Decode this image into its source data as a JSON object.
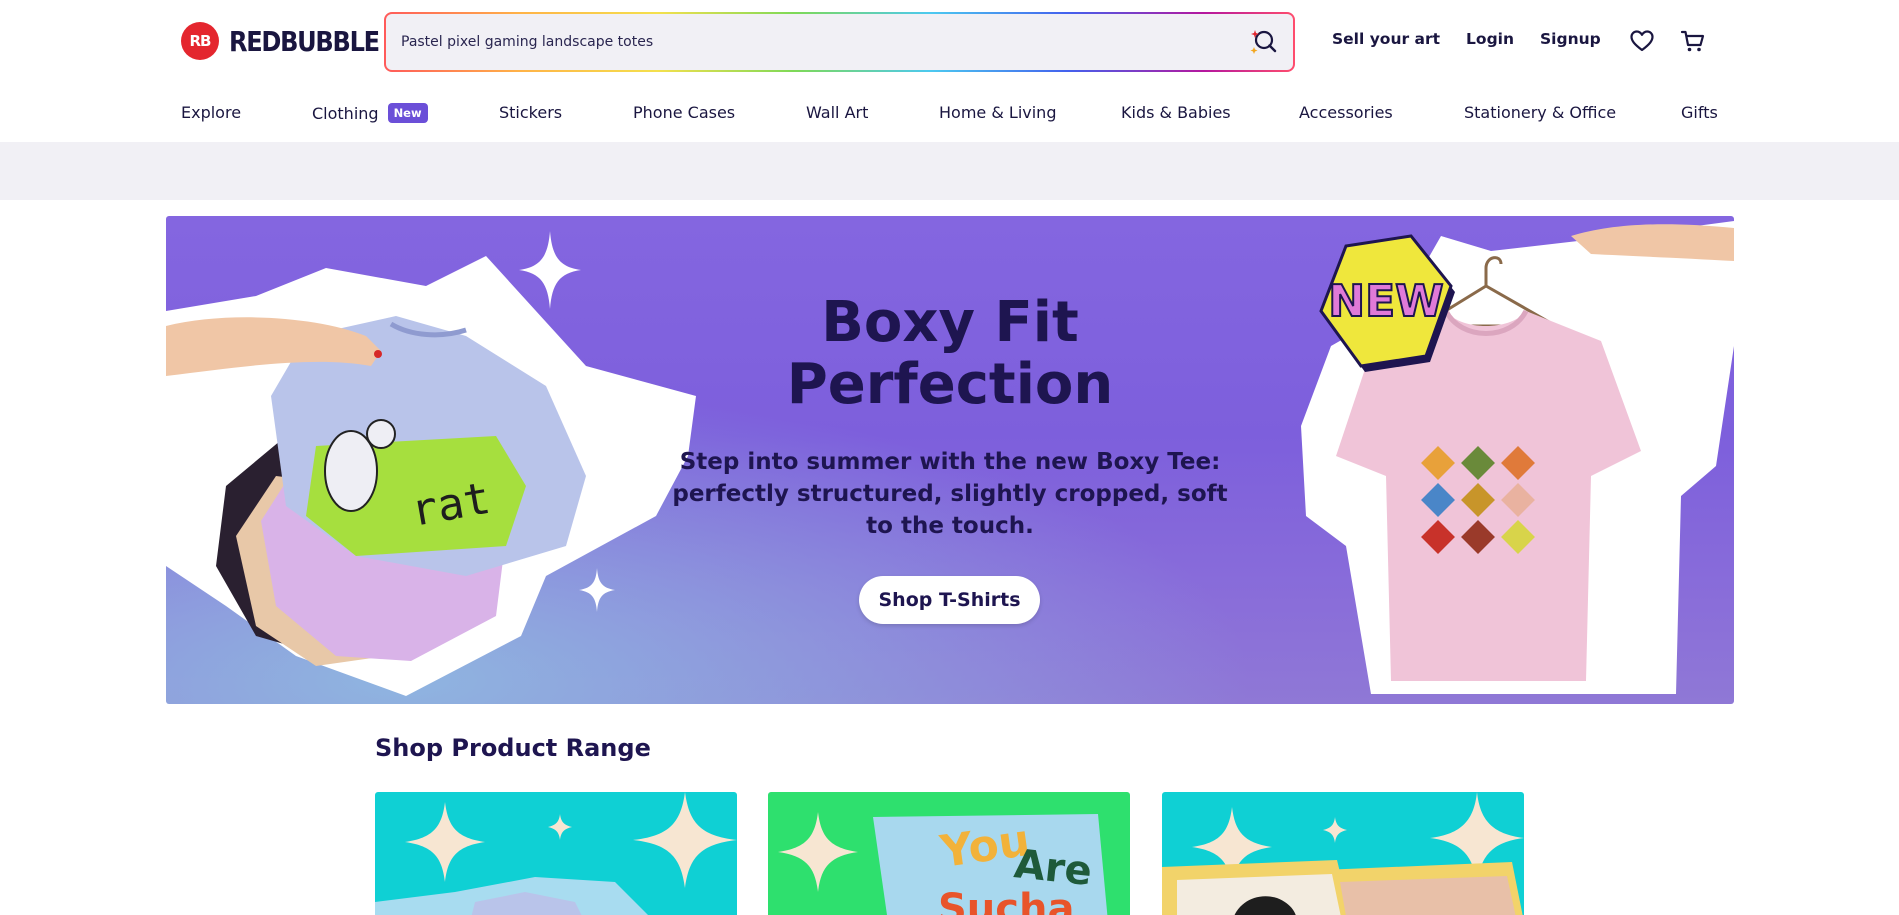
{
  "brand": {
    "logo_mark": "RB",
    "name": "REDBUBBLE",
    "color": "#e4262e"
  },
  "search": {
    "value": "Pastel pixel gaming landscape totes",
    "icon": "search-sparkle-icon"
  },
  "header": {
    "sell_label": "Sell your art",
    "login_label": "Login",
    "signup_label": "Signup",
    "wishlist_icon": "heart-icon",
    "cart_icon": "cart-icon"
  },
  "nav": {
    "items": [
      {
        "label": "Explore"
      },
      {
        "label": "Clothing",
        "badge": "New"
      },
      {
        "label": "Stickers"
      },
      {
        "label": "Phone Cases"
      },
      {
        "label": "Wall Art"
      },
      {
        "label": "Home & Living"
      },
      {
        "label": "Kids & Babies"
      },
      {
        "label": "Accessories"
      },
      {
        "label": "Stationery & Office"
      },
      {
        "label": "Gifts"
      }
    ]
  },
  "hero": {
    "title_line1": "Boxy Fit",
    "title_line2": "Perfection",
    "subtitle": "Step into summer with the new Boxy Tee: perfectly structured, slightly cropped, soft to the touch.",
    "cta_label": "Shop T-Shirts",
    "new_badge": "NEW",
    "shirt_print_text": "rat",
    "background_color": "#8466e0"
  },
  "product_range": {
    "title": "Shop Product Range",
    "card_text": [
      "You",
      "Are",
      "Sucha"
    ]
  }
}
